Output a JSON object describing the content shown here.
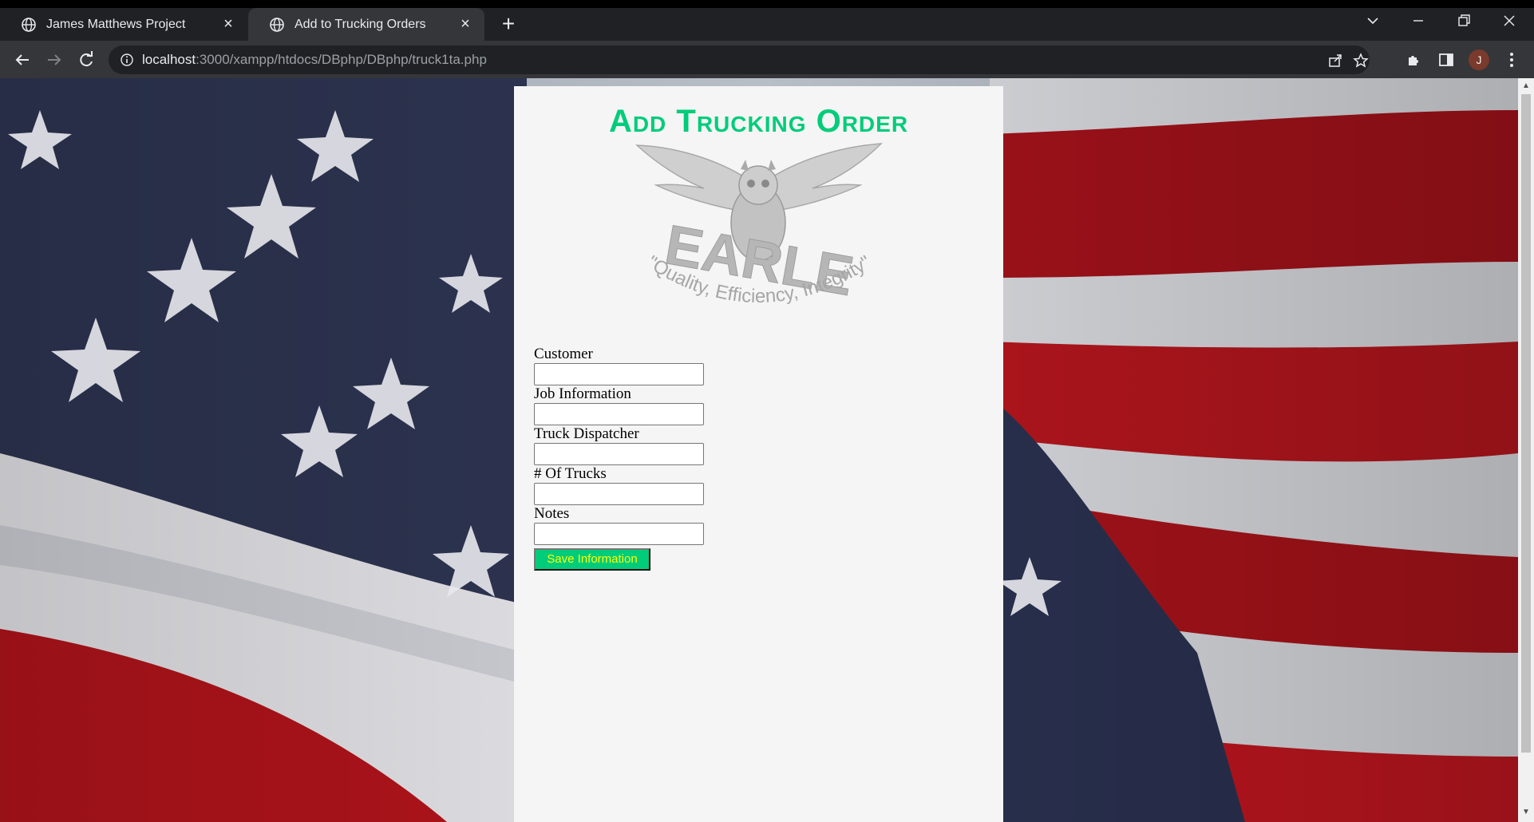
{
  "browser": {
    "tabs": [
      {
        "title": "James Matthews Project",
        "active": false
      },
      {
        "title": "Add to Trucking Orders",
        "active": true
      }
    ],
    "url_host": "localhost",
    "url_path": ":3000/xampp/htdocs/DBphp/DBphp/truck1ta.php",
    "profile_initial": "J"
  },
  "page": {
    "title": "Add Trucking Order",
    "logo": {
      "name": "EARLE",
      "tagline": "\"Quality, Efficiency, Integrity\""
    },
    "form": {
      "fields": [
        {
          "label": "Customer",
          "value": ""
        },
        {
          "label": "Job Information",
          "value": ""
        },
        {
          "label": "Truck Dispatcher",
          "value": ""
        },
        {
          "label": "# Of Trucks",
          "value": ""
        },
        {
          "label": "Notes",
          "value": ""
        }
      ],
      "submit_label": "Save Information"
    }
  },
  "colors": {
    "title": "#00cc7a",
    "button_bg": "#00cc7a",
    "button_text": "#ffff00",
    "panel_bg": "#f5f5f5"
  }
}
